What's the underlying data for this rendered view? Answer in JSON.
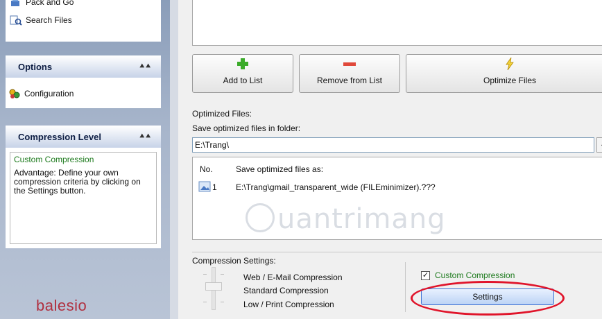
{
  "left_panel": {
    "tasks_top": [
      {
        "label": "Pack and Go",
        "icon": "pack-icon"
      },
      {
        "label": "Search Files",
        "icon": "search-files-icon"
      }
    ],
    "options": {
      "header": "Options",
      "items": [
        {
          "label": "Configuration",
          "icon": "configuration-icon"
        }
      ]
    },
    "compression_level": {
      "header": "Compression Level",
      "title": "Custom Compression",
      "description": "Advantage: Define your own compression criteria by clicking on the Settings button."
    },
    "logo": "balesio"
  },
  "toolbar": {
    "add_label": "Add to List",
    "remove_label": "Remove from List",
    "optimize_label": "Optimize Files"
  },
  "optimized_files": {
    "group_label": "Optimized Files:",
    "folder_label": "Save optimized files in folder:",
    "folder_value": "E:\\Trang\\",
    "browse_label": "...",
    "columns": [
      "No.",
      "Save optimized files as:"
    ],
    "rows": [
      {
        "no": "1",
        "path": "E:\\Trang\\gmail_transparent_wide (FILEminimizer).???"
      }
    ]
  },
  "watermark": "uantrimang",
  "compression_settings": {
    "group_label": "Compression Settings:",
    "levels": [
      "Web / E-Mail Compression",
      "Standard Compression",
      "Low / Print Compression"
    ],
    "selected_level": "Standard Compression",
    "custom_label": "Custom Compression",
    "custom_checked": true,
    "checkmark": "✓",
    "settings_label": "Settings"
  },
  "colors": {
    "accent_green": "#1d7a1d",
    "highlight_red": "#e0142a",
    "logo": "#b03040"
  }
}
